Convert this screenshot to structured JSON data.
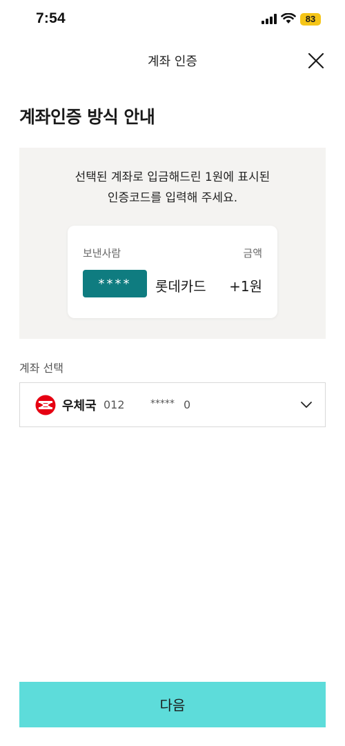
{
  "status_bar": {
    "time": "7:54",
    "battery": "83",
    "icons": [
      "signal-icon",
      "wifi-icon"
    ]
  },
  "header": {
    "title": "계좌 인증",
    "close_icon": "close-icon"
  },
  "page_title": "계좌인증 방식 안내",
  "instruction": {
    "line1": "선택된 계좌로 입금해드린 1원에 표시된",
    "line2": "인증코드를 입력해 주세요."
  },
  "deposit_card": {
    "sender_label": "보낸사람",
    "amount_label": "금액",
    "code_mask": "****",
    "sender_name": "롯데카드",
    "amount": "+1원"
  },
  "account": {
    "label": "계좌 선택",
    "bank_name": "우체국",
    "prefix": "012",
    "masked": "*****",
    "suffix": "0",
    "icons": [
      "bank-logo-icon",
      "chevron-down-icon"
    ]
  },
  "next_button": {
    "label": "다음"
  },
  "colors": {
    "accent": "#5ddcda",
    "code_box": "#0f7c80",
    "battery": "#f5c518",
    "panel_bg": "#f4f3f1",
    "bank_logo": "#e60012"
  }
}
